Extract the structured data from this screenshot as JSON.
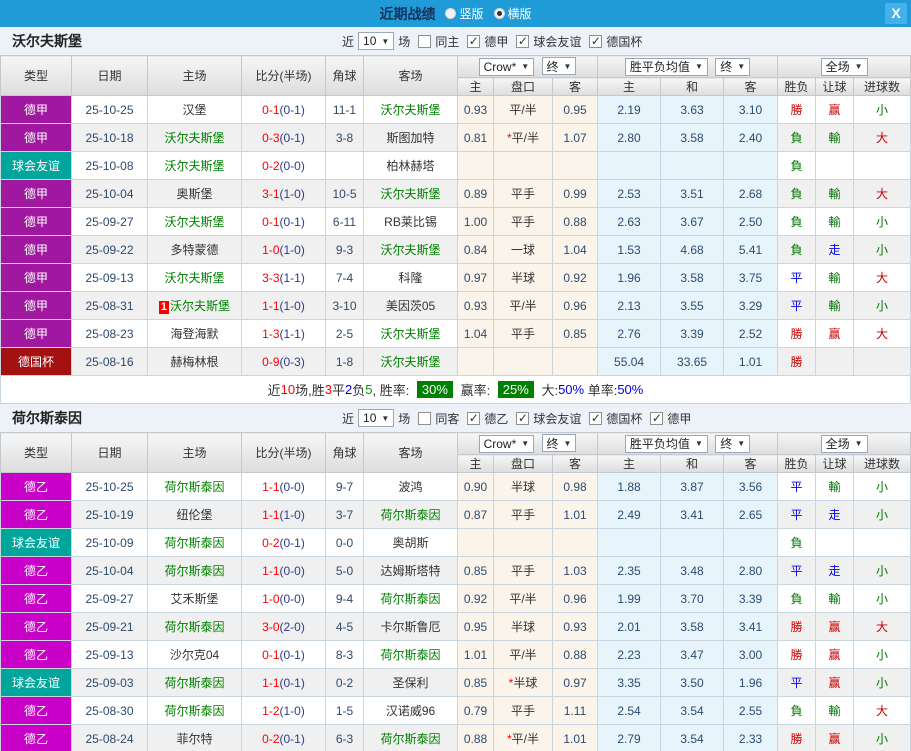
{
  "titlebar": {
    "title": "近期战绩",
    "radio_options": [
      {
        "label": "竖版",
        "selected": false
      },
      {
        "label": "横版",
        "selected": true
      }
    ],
    "close_label": "X"
  },
  "header": {
    "col_type": "类型",
    "col_date": "日期",
    "col_home": "主场",
    "col_score": "比分(半场)",
    "col_corner": "角球",
    "col_away": "客场",
    "col_odds_home": "主",
    "col_handicap": "盘口",
    "col_odds_away": "客",
    "col_avg_home": "主",
    "col_avg_draw": "和",
    "col_avg_away": "客",
    "col_result": "胜负",
    "col_let": "让球",
    "col_goals": "进球数",
    "dd_odds_source": "Crow*",
    "dd_final_1": "终",
    "dd_avg": "胜平负均值",
    "dd_final_2": "终",
    "dd_scope": "全场"
  },
  "colors": {
    "league": {
      "德甲": "#A018A0",
      "德乙": "#C800C8",
      "球会友谊": "#00A69C",
      "德国杯": "#A31111"
    },
    "result": {
      "r": "#CC0000",
      "g": "#007500",
      "b": "#0000E6"
    },
    "text": {
      "k": "#333333",
      "r": "#FF0000",
      "g": "#009900",
      "b": "#0000E0"
    },
    "accent_titlebar": "#1F9BD7",
    "score": "#FF0000",
    "halftime": "#2F3C8E",
    "focus_team": "#008000",
    "rate_badge": "#008000"
  },
  "sections": [
    {
      "team": "沃尔夫斯堡",
      "filter": {
        "prefix": "近",
        "count": "10",
        "suffix": "场",
        "same_label": "同主",
        "same_checked": false,
        "leagues": [
          {
            "label": "德甲",
            "checked": true
          },
          {
            "label": "球会友谊",
            "checked": true
          },
          {
            "label": "德国杯",
            "checked": true
          }
        ]
      },
      "rows": [
        {
          "type": "德甲",
          "date": "25-10-25",
          "home": "汉堡",
          "home_focus": false,
          "badge": "",
          "score": "0-1",
          "half": "(0-1)",
          "corner": "11-1",
          "away": "沃尔夫斯堡",
          "away_focus": true,
          "o1": "0.93",
          "pan": "平/半",
          "star": false,
          "o2": "0.95",
          "m1": "2.19",
          "m2": "3.63",
          "m3": "3.10",
          "res": "勝",
          "res_c": "r",
          "rang": "赢",
          "rang_c": "r",
          "da": "小",
          "da_c": "g"
        },
        {
          "type": "德甲",
          "date": "25-10-18",
          "home": "沃尔夫斯堡",
          "home_focus": true,
          "badge": "",
          "score": "0-3",
          "half": "(0-1)",
          "corner": "3-8",
          "away": "斯图加特",
          "away_focus": false,
          "o1": "0.81",
          "pan": "平/半",
          "star": true,
          "o2": "1.07",
          "m1": "2.80",
          "m2": "3.58",
          "m3": "2.40",
          "res": "負",
          "res_c": "g",
          "rang": "輸",
          "rang_c": "g",
          "da": "大",
          "da_c": "r"
        },
        {
          "type": "球会友谊",
          "date": "25-10-08",
          "home": "沃尔夫斯堡",
          "home_focus": true,
          "badge": "",
          "score": "0-2",
          "half": "(0-0)",
          "corner": "",
          "away": "柏林赫塔",
          "away_focus": false,
          "o1": "",
          "pan": "",
          "star": false,
          "o2": "",
          "m1": "",
          "m2": "",
          "m3": "",
          "res": "負",
          "res_c": "g",
          "rang": "",
          "rang_c": "k",
          "da": "",
          "da_c": "k"
        },
        {
          "type": "德甲",
          "date": "25-10-04",
          "home": "奥斯堡",
          "home_focus": false,
          "badge": "",
          "score": "3-1",
          "half": "(1-0)",
          "corner": "10-5",
          "away": "沃尔夫斯堡",
          "away_focus": true,
          "o1": "0.89",
          "pan": "平手",
          "star": false,
          "o2": "0.99",
          "m1": "2.53",
          "m2": "3.51",
          "m3": "2.68",
          "res": "負",
          "res_c": "g",
          "rang": "輸",
          "rang_c": "g",
          "da": "大",
          "da_c": "r"
        },
        {
          "type": "德甲",
          "date": "25-09-27",
          "home": "沃尔夫斯堡",
          "home_focus": true,
          "badge": "",
          "score": "0-1",
          "half": "(0-1)",
          "corner": "6-11",
          "away": "RB莱比锡",
          "away_focus": false,
          "o1": "1.00",
          "pan": "平手",
          "star": false,
          "o2": "0.88",
          "m1": "2.63",
          "m2": "3.67",
          "m3": "2.50",
          "res": "負",
          "res_c": "g",
          "rang": "輸",
          "rang_c": "g",
          "da": "小",
          "da_c": "g"
        },
        {
          "type": "德甲",
          "date": "25-09-22",
          "home": "多特蒙德",
          "home_focus": false,
          "badge": "",
          "score": "1-0",
          "half": "(1-0)",
          "corner": "9-3",
          "away": "沃尔夫斯堡",
          "away_focus": true,
          "o1": "0.84",
          "pan": "一球",
          "star": false,
          "o2": "1.04",
          "m1": "1.53",
          "m2": "4.68",
          "m3": "5.41",
          "res": "負",
          "res_c": "g",
          "rang": "走",
          "rang_c": "b",
          "da": "小",
          "da_c": "g"
        },
        {
          "type": "德甲",
          "date": "25-09-13",
          "home": "沃尔夫斯堡",
          "home_focus": true,
          "badge": "",
          "score": "3-3",
          "half": "(1-1)",
          "corner": "7-4",
          "away": "科隆",
          "away_focus": false,
          "o1": "0.97",
          "pan": "半球",
          "star": false,
          "o2": "0.92",
          "m1": "1.96",
          "m2": "3.58",
          "m3": "3.75",
          "res": "平",
          "res_c": "b",
          "rang": "輸",
          "rang_c": "g",
          "da": "大",
          "da_c": "r"
        },
        {
          "type": "德甲",
          "date": "25-08-31",
          "home": "沃尔夫斯堡",
          "home_focus": true,
          "badge": "1",
          "score": "1-1",
          "half": "(1-0)",
          "corner": "3-10",
          "away": "美因茨05",
          "away_focus": false,
          "o1": "0.93",
          "pan": "平/半",
          "star": false,
          "o2": "0.96",
          "m1": "2.13",
          "m2": "3.55",
          "m3": "3.29",
          "res": "平",
          "res_c": "b",
          "rang": "輸",
          "rang_c": "g",
          "da": "小",
          "da_c": "g"
        },
        {
          "type": "德甲",
          "date": "25-08-23",
          "home": "海登海默",
          "home_focus": false,
          "badge": "",
          "score": "1-3",
          "half": "(1-1)",
          "corner": "2-5",
          "away": "沃尔夫斯堡",
          "away_focus": true,
          "o1": "1.04",
          "pan": "平手",
          "star": false,
          "o2": "0.85",
          "m1": "2.76",
          "m2": "3.39",
          "m3": "2.52",
          "res": "勝",
          "res_c": "r",
          "rang": "赢",
          "rang_c": "r",
          "da": "大",
          "da_c": "r"
        },
        {
          "type": "德国杯",
          "date": "25-08-16",
          "home": "赫梅林根",
          "home_focus": false,
          "badge": "",
          "score": "0-9",
          "half": "(0-3)",
          "corner": "1-8",
          "away": "沃尔夫斯堡",
          "away_focus": true,
          "o1": "",
          "pan": "",
          "star": false,
          "o2": "",
          "m1": "55.04",
          "m2": "33.65",
          "m3": "1.01",
          "res": "勝",
          "res_c": "r",
          "rang": "",
          "rang_c": "k",
          "da": "",
          "da_c": "k"
        }
      ],
      "summary_pieces": [
        {
          "t": "近",
          "c": "k"
        },
        {
          "t": "10",
          "c": "r"
        },
        {
          "t": "场,胜",
          "c": "k"
        },
        {
          "t": "3",
          "c": "r"
        },
        {
          "t": "平",
          "c": "k"
        },
        {
          "t": "2",
          "c": "b"
        },
        {
          "t": "负",
          "c": "k"
        },
        {
          "t": "5",
          "c": "g"
        },
        {
          "t": ", 胜率: ",
          "c": "k"
        },
        {
          "t": "30%",
          "c": "badge"
        },
        {
          "t": " 赢率: ",
          "c": "k"
        },
        {
          "t": "25%",
          "c": "badge"
        },
        {
          "t": " 大:",
          "c": "k"
        },
        {
          "t": "50%",
          "c": "b"
        },
        {
          "t": " 单率:",
          "c": "k"
        },
        {
          "t": "50%",
          "c": "b"
        }
      ]
    },
    {
      "team": "荷尔斯泰因",
      "filter": {
        "prefix": "近",
        "count": "10",
        "suffix": "场",
        "same_label": "同客",
        "same_checked": false,
        "leagues": [
          {
            "label": "德乙",
            "checked": true
          },
          {
            "label": "球会友谊",
            "checked": true
          },
          {
            "label": "德国杯",
            "checked": true
          },
          {
            "label": "德甲",
            "checked": true
          }
        ]
      },
      "rows": [
        {
          "type": "德乙",
          "date": "25-10-25",
          "home": "荷尔斯泰因",
          "home_focus": true,
          "badge": "",
          "score": "1-1",
          "half": "(0-0)",
          "corner": "9-7",
          "away": "波鸿",
          "away_focus": false,
          "o1": "0.90",
          "pan": "半球",
          "star": false,
          "o2": "0.98",
          "m1": "1.88",
          "m2": "3.87",
          "m3": "3.56",
          "res": "平",
          "res_c": "b",
          "rang": "輸",
          "rang_c": "g",
          "da": "小",
          "da_c": "g"
        },
        {
          "type": "德乙",
          "date": "25-10-19",
          "home": "纽伦堡",
          "home_focus": false,
          "badge": "",
          "score": "1-1",
          "half": "(1-0)",
          "corner": "3-7",
          "away": "荷尔斯泰因",
          "away_focus": true,
          "o1": "0.87",
          "pan": "平手",
          "star": false,
          "o2": "1.01",
          "m1": "2.49",
          "m2": "3.41",
          "m3": "2.65",
          "res": "平",
          "res_c": "b",
          "rang": "走",
          "rang_c": "b",
          "da": "小",
          "da_c": "g"
        },
        {
          "type": "球会友谊",
          "date": "25-10-09",
          "home": "荷尔斯泰因",
          "home_focus": true,
          "badge": "",
          "score": "0-2",
          "half": "(0-1)",
          "corner": "0-0",
          "away": "奥胡斯",
          "away_focus": false,
          "o1": "",
          "pan": "",
          "star": false,
          "o2": "",
          "m1": "",
          "m2": "",
          "m3": "",
          "res": "負",
          "res_c": "g",
          "rang": "",
          "rang_c": "k",
          "da": "",
          "da_c": "k"
        },
        {
          "type": "德乙",
          "date": "25-10-04",
          "home": "荷尔斯泰因",
          "home_focus": true,
          "badge": "",
          "score": "1-1",
          "half": "(0-0)",
          "corner": "5-0",
          "away": "达姆斯塔特",
          "away_focus": false,
          "o1": "0.85",
          "pan": "平手",
          "star": false,
          "o2": "1.03",
          "m1": "2.35",
          "m2": "3.48",
          "m3": "2.80",
          "res": "平",
          "res_c": "b",
          "rang": "走",
          "rang_c": "b",
          "da": "小",
          "da_c": "g"
        },
        {
          "type": "德乙",
          "date": "25-09-27",
          "home": "艾禾斯堡",
          "home_focus": false,
          "badge": "",
          "score": "1-0",
          "half": "(0-0)",
          "corner": "9-4",
          "away": "荷尔斯泰因",
          "away_focus": true,
          "o1": "0.92",
          "pan": "平/半",
          "star": false,
          "o2": "0.96",
          "m1": "1.99",
          "m2": "3.70",
          "m3": "3.39",
          "res": "負",
          "res_c": "g",
          "rang": "輸",
          "rang_c": "g",
          "da": "小",
          "da_c": "g"
        },
        {
          "type": "德乙",
          "date": "25-09-21",
          "home": "荷尔斯泰因",
          "home_focus": true,
          "badge": "",
          "score": "3-0",
          "half": "(2-0)",
          "corner": "4-5",
          "away": "卡尔斯鲁厄",
          "away_focus": false,
          "o1": "0.95",
          "pan": "半球",
          "star": false,
          "o2": "0.93",
          "m1": "2.01",
          "m2": "3.58",
          "m3": "3.41",
          "res": "勝",
          "res_c": "r",
          "rang": "赢",
          "rang_c": "r",
          "da": "大",
          "da_c": "r"
        },
        {
          "type": "德乙",
          "date": "25-09-13",
          "home": "沙尔克04",
          "home_focus": false,
          "badge": "",
          "score": "0-1",
          "half": "(0-1)",
          "corner": "8-3",
          "away": "荷尔斯泰因",
          "away_focus": true,
          "o1": "1.01",
          "pan": "平/半",
          "star": false,
          "o2": "0.88",
          "m1": "2.23",
          "m2": "3.47",
          "m3": "3.00",
          "res": "勝",
          "res_c": "r",
          "rang": "赢",
          "rang_c": "r",
          "da": "小",
          "da_c": "g"
        },
        {
          "type": "球会友谊",
          "date": "25-09-03",
          "home": "荷尔斯泰因",
          "home_focus": true,
          "badge": "",
          "score": "1-1",
          "half": "(0-1)",
          "corner": "0-2",
          "away": "圣保利",
          "away_focus": false,
          "o1": "0.85",
          "pan": "半球",
          "star": true,
          "o2": "0.97",
          "m1": "3.35",
          "m2": "3.50",
          "m3": "1.96",
          "res": "平",
          "res_c": "b",
          "rang": "赢",
          "rang_c": "r",
          "da": "小",
          "da_c": "g"
        },
        {
          "type": "德乙",
          "date": "25-08-30",
          "home": "荷尔斯泰因",
          "home_focus": true,
          "badge": "",
          "score": "1-2",
          "half": "(1-0)",
          "corner": "1-5",
          "away": "汉诺威96",
          "away_focus": false,
          "o1": "0.79",
          "pan": "平手",
          "star": false,
          "o2": "1.11",
          "m1": "2.54",
          "m2": "3.54",
          "m3": "2.55",
          "res": "負",
          "res_c": "g",
          "rang": "輸",
          "rang_c": "g",
          "da": "大",
          "da_c": "r"
        },
        {
          "type": "德乙",
          "date": "25-08-24",
          "home": "菲尔特",
          "home_focus": false,
          "badge": "",
          "score": "0-2",
          "half": "(0-1)",
          "corner": "6-3",
          "away": "荷尔斯泰因",
          "away_focus": true,
          "o1": "0.88",
          "pan": "平/半",
          "star": true,
          "o2": "1.01",
          "m1": "2.79",
          "m2": "3.54",
          "m3": "2.33",
          "res": "勝",
          "res_c": "r",
          "rang": "赢",
          "rang_c": "r",
          "da": "小",
          "da_c": "g"
        }
      ],
      "summary_pieces": null
    }
  ]
}
